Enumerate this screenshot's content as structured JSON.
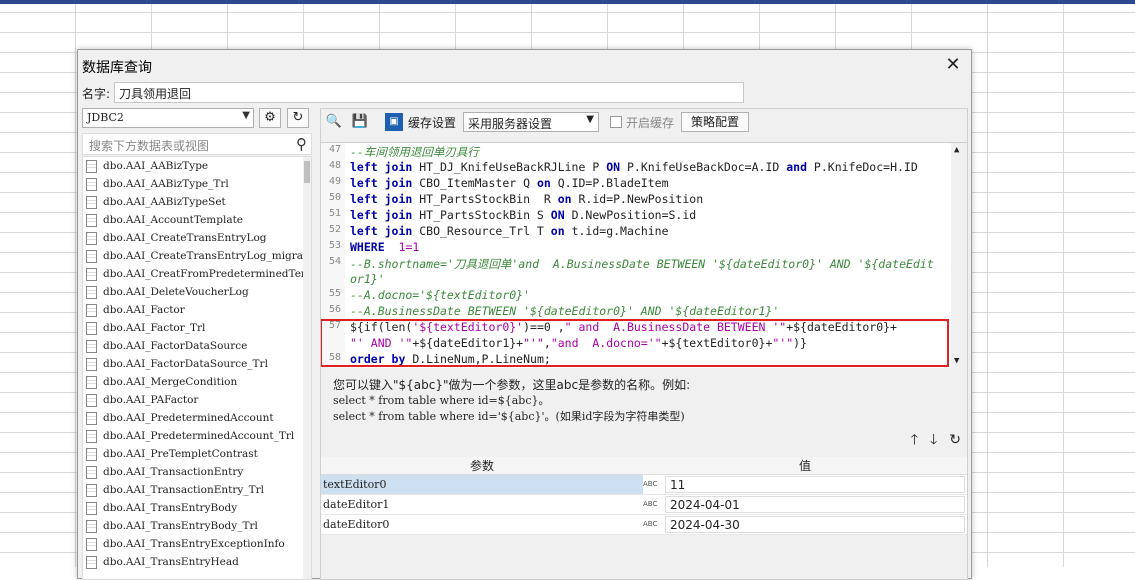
{
  "dialog": {
    "title": "数据库查询",
    "close": "✕",
    "name_label": "名字:",
    "name_value": "刀具领用退回"
  },
  "left": {
    "connection": "JDBC2",
    "search_placeholder": "搜索下方数据表或视图",
    "tables": [
      "dbo.AAI_AABizType",
      "dbo.AAI_AABizType_Trl",
      "dbo.AAI_AABizTypeSet",
      "dbo.AAI_AccountTemplate",
      "dbo.AAI_CreateTransEntryLog",
      "dbo.AAI_CreateTransEntryLog_migra",
      "dbo.AAI_CreatFromPredeterminedTem",
      "dbo.AAI_DeleteVoucherLog",
      "dbo.AAI_Factor",
      "dbo.AAI_Factor_Trl",
      "dbo.AAI_FactorDataSource",
      "dbo.AAI_FactorDataSource_Trl",
      "dbo.AAI_MergeCondition",
      "dbo.AAI_PAFactor",
      "dbo.AAI_PredeterminedAccount",
      "dbo.AAI_PredeterminedAccount_Trl",
      "dbo.AAI_PreTempletContrast",
      "dbo.AAI_TransactionEntry",
      "dbo.AAI_TransactionEntry_Trl",
      "dbo.AAI_TransEntryBody",
      "dbo.AAI_TransEntryBody_Trl",
      "dbo.AAI_TransEntryExceptionInfo",
      "dbo.AAI_TransEntryHead"
    ]
  },
  "toolbar": {
    "cache_label": "缓存设置",
    "cache_option": "采用服务器设置",
    "enable_cache": "开启缓存",
    "strategy": "策略配置"
  },
  "editor": {
    "line_numbers": [
      "47",
      "48",
      "49",
      "50",
      "51",
      "52",
      "53",
      "54",
      "",
      "55",
      "56",
      "57",
      "",
      "58"
    ]
  },
  "help": {
    "line1": "您可以键入\"${abc}\"做为一个参数，这里abc是参数的名称。例如:",
    "line2": "select * from table where id=${abc}。",
    "line3": "select * from table where id='${abc}'。(如果id字段为字符串类型)"
  },
  "params": {
    "col_param": "参数",
    "col_value": "值",
    "type_label": "ABC",
    "rows": [
      {
        "name": "textEditor0",
        "value": "11"
      },
      {
        "name": "dateEditor1",
        "value": "2024-04-01"
      },
      {
        "name": "dateEditor0",
        "value": "2024-04-30"
      }
    ]
  }
}
